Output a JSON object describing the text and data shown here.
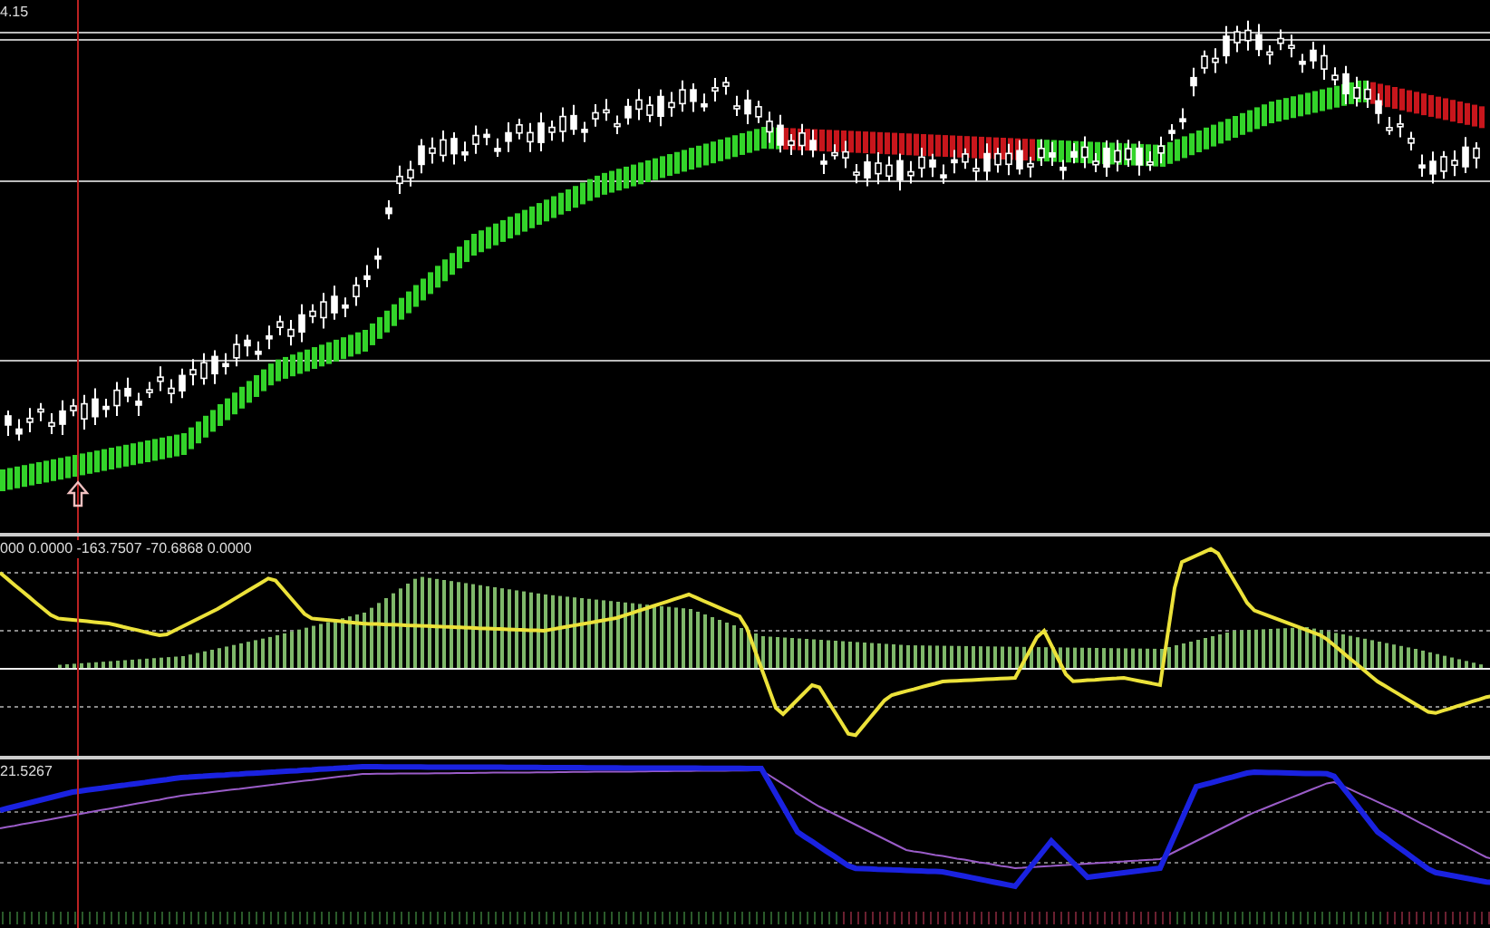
{
  "main_chart": {
    "price_label": "4.15"
  },
  "oscillator_panel": {
    "values_label": "000 0.0000 -163.7507 -70.6868 0.0000"
  },
  "lower_panel": {
    "value_label": "21.5267"
  }
}
